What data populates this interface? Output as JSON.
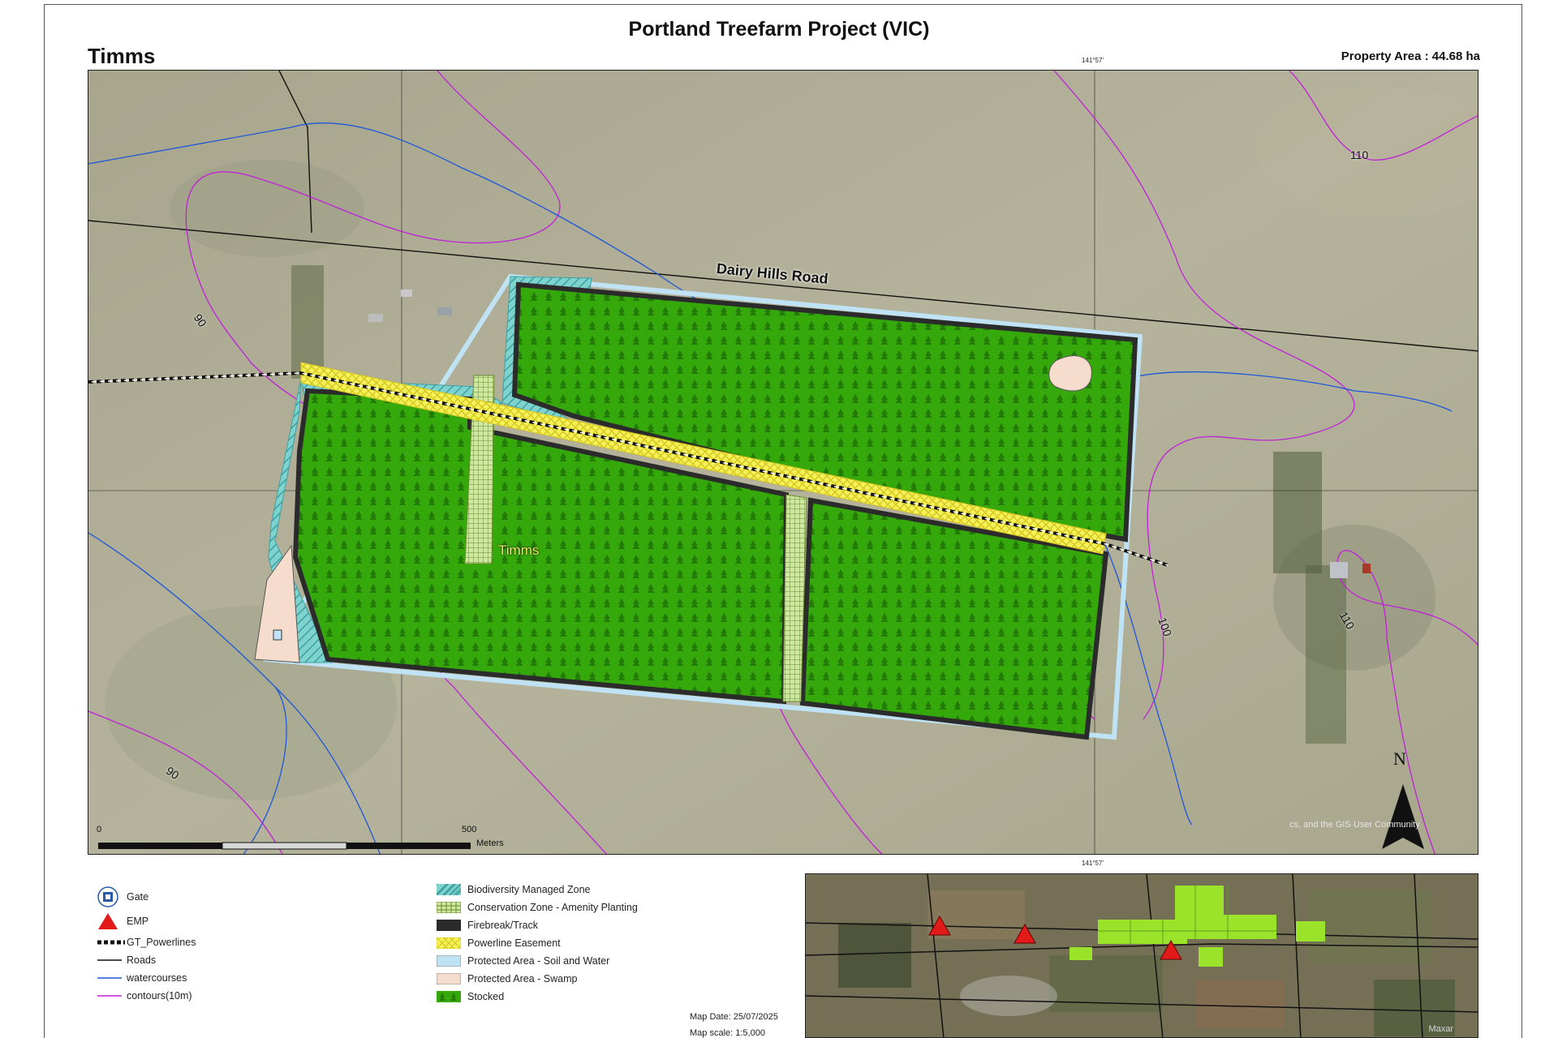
{
  "header": {
    "title": "Portland Treefarm Project (VIC)",
    "property_name": "Timms",
    "property_area": "Property Area : 44.68 ha"
  },
  "map": {
    "road_label": "Dairy Hills Road",
    "property_label": "Timms",
    "contour_labels": [
      "110",
      "90",
      "100",
      "110",
      "90"
    ],
    "grid_coord_top": "141°57'",
    "grid_coord_bottom": "141°57'",
    "north_label": "N",
    "scale_start": "0",
    "scale_mid": "500",
    "scale_unit": "Meters",
    "attribution": "cs, and the GIS User Community"
  },
  "legend_left": [
    {
      "label": "Gate",
      "icon": "gate-icon"
    },
    {
      "label": "EMP",
      "icon": "red-triangle-icon"
    },
    {
      "label": "GT_Powerlines",
      "icon": "powerline-line-icon"
    },
    {
      "label": "Roads",
      "icon": "road-line-icon"
    },
    {
      "label": "watercourses",
      "icon": "watercourse-line-icon"
    },
    {
      "label": "contours(10m)",
      "icon": "contour-line-icon"
    }
  ],
  "legend_right": [
    {
      "label": "Biodiversity Managed Zone",
      "icon": "hatched-teal-swatch"
    },
    {
      "label": "Conservation Zone - Amenity Planting",
      "icon": "grid-lightgreen-swatch"
    },
    {
      "label": "Firebreak/Track",
      "icon": "dark-swatch"
    },
    {
      "label": "Powerline Easement",
      "icon": "yellow-crosshatch-swatch"
    },
    {
      "label": "Protected Area - Soil and Water",
      "icon": "lightblue-swatch"
    },
    {
      "label": "Protected Area - Swamp",
      "icon": "peach-swatch"
    },
    {
      "label": "Stocked",
      "icon": "green-tree-swatch"
    }
  ],
  "meta": {
    "map_date": "Map Date: 25/07/2025",
    "map_scale": "Map scale: 1:5,000"
  },
  "inset": {
    "attribution": "Maxar"
  },
  "colors": {
    "stocked": "#35a80c",
    "firebreak": "#2b2b2b",
    "powerline_easement": "#f3f25a",
    "biodiversity": "#7fd3cf",
    "conservation": "#cfe8a0",
    "swamp": "#f6dccd",
    "soil_water": "#bfe3f5",
    "contour": "#c020d8",
    "watercourse": "#1e57d8",
    "emp": "#e31a1a"
  }
}
